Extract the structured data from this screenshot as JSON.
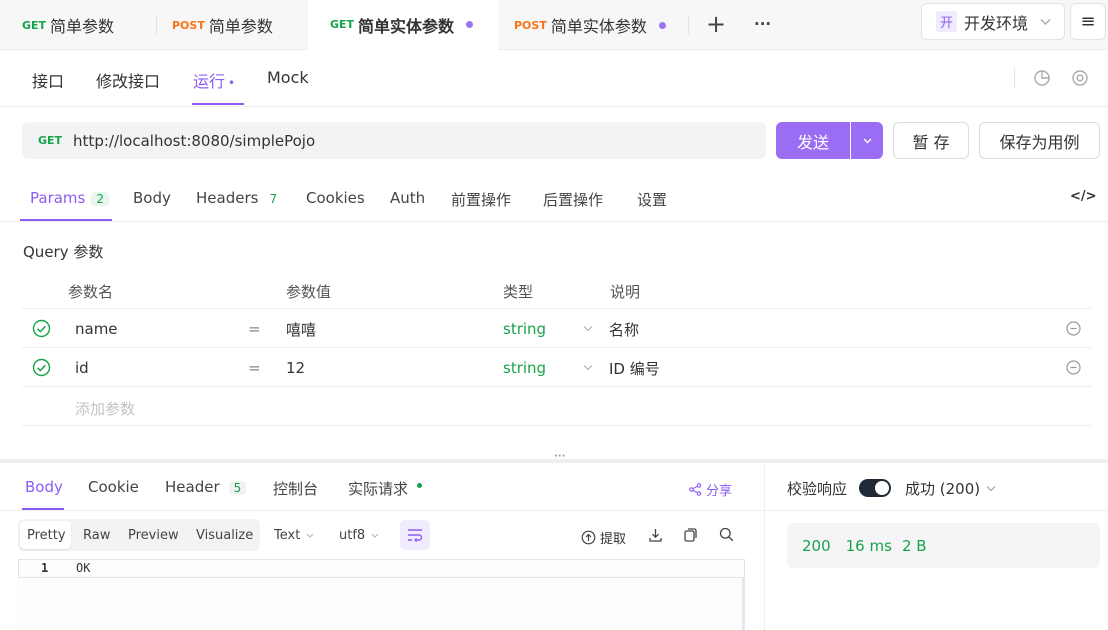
{
  "tabs": [
    {
      "method": "GET",
      "label": "简单参数"
    },
    {
      "method": "POST",
      "label": "简单参数"
    },
    {
      "method": "GET",
      "label": "简单实体参数"
    },
    {
      "method": "POST",
      "label": "简单实体参数"
    }
  ],
  "tabbar": {
    "add": "+",
    "more": "···",
    "env_badge": "开",
    "env_label": "开发环境",
    "menu": "≡"
  },
  "subnav": {
    "items": [
      "接口",
      "修改接口",
      "运行",
      "Mock"
    ],
    "run_dot": "•"
  },
  "request": {
    "method": "GET",
    "url": "http://localhost:8080/simplePojo",
    "send": "发送",
    "save": "暂 存",
    "save_case": "保存为用例"
  },
  "param_tabs": {
    "params": "Params",
    "params_count": "2",
    "body": "Body",
    "headers": "Headers",
    "headers_count": "7",
    "cookies": "Cookies",
    "auth": "Auth",
    "pre": "前置操作",
    "post": "后置操作",
    "settings": "设置",
    "code": "</>"
  },
  "query": {
    "title": "Query 参数",
    "headers": [
      "参数名",
      "参数值",
      "类型",
      "说明"
    ],
    "rows": [
      {
        "name": "name",
        "eq": "=",
        "value": "嘻嘻",
        "type": "string",
        "desc": "名称"
      },
      {
        "name": "id",
        "eq": "=",
        "value": "12",
        "type": "string",
        "desc": "ID 编号"
      }
    ],
    "add_placeholder": "添加参数"
  },
  "response": {
    "tabs": {
      "body": "Body",
      "cookie": "Cookie",
      "header": "Header",
      "header_count": "5",
      "console": "控制台",
      "actual": "实际请求"
    },
    "share": "分享",
    "formats": [
      "Pretty",
      "Raw",
      "Preview",
      "Visualize"
    ],
    "text_type": "Text",
    "encoding": "utf8",
    "extract": "提取",
    "line_no": "1",
    "content": "OK",
    "validate_label": "校验响应",
    "result": "成功 (200)",
    "status": "200",
    "time": "16 ms",
    "size": "2 B"
  },
  "colors": {
    "accent": "#8b5cf6",
    "get": "#17a34a",
    "post": "#f97316"
  }
}
